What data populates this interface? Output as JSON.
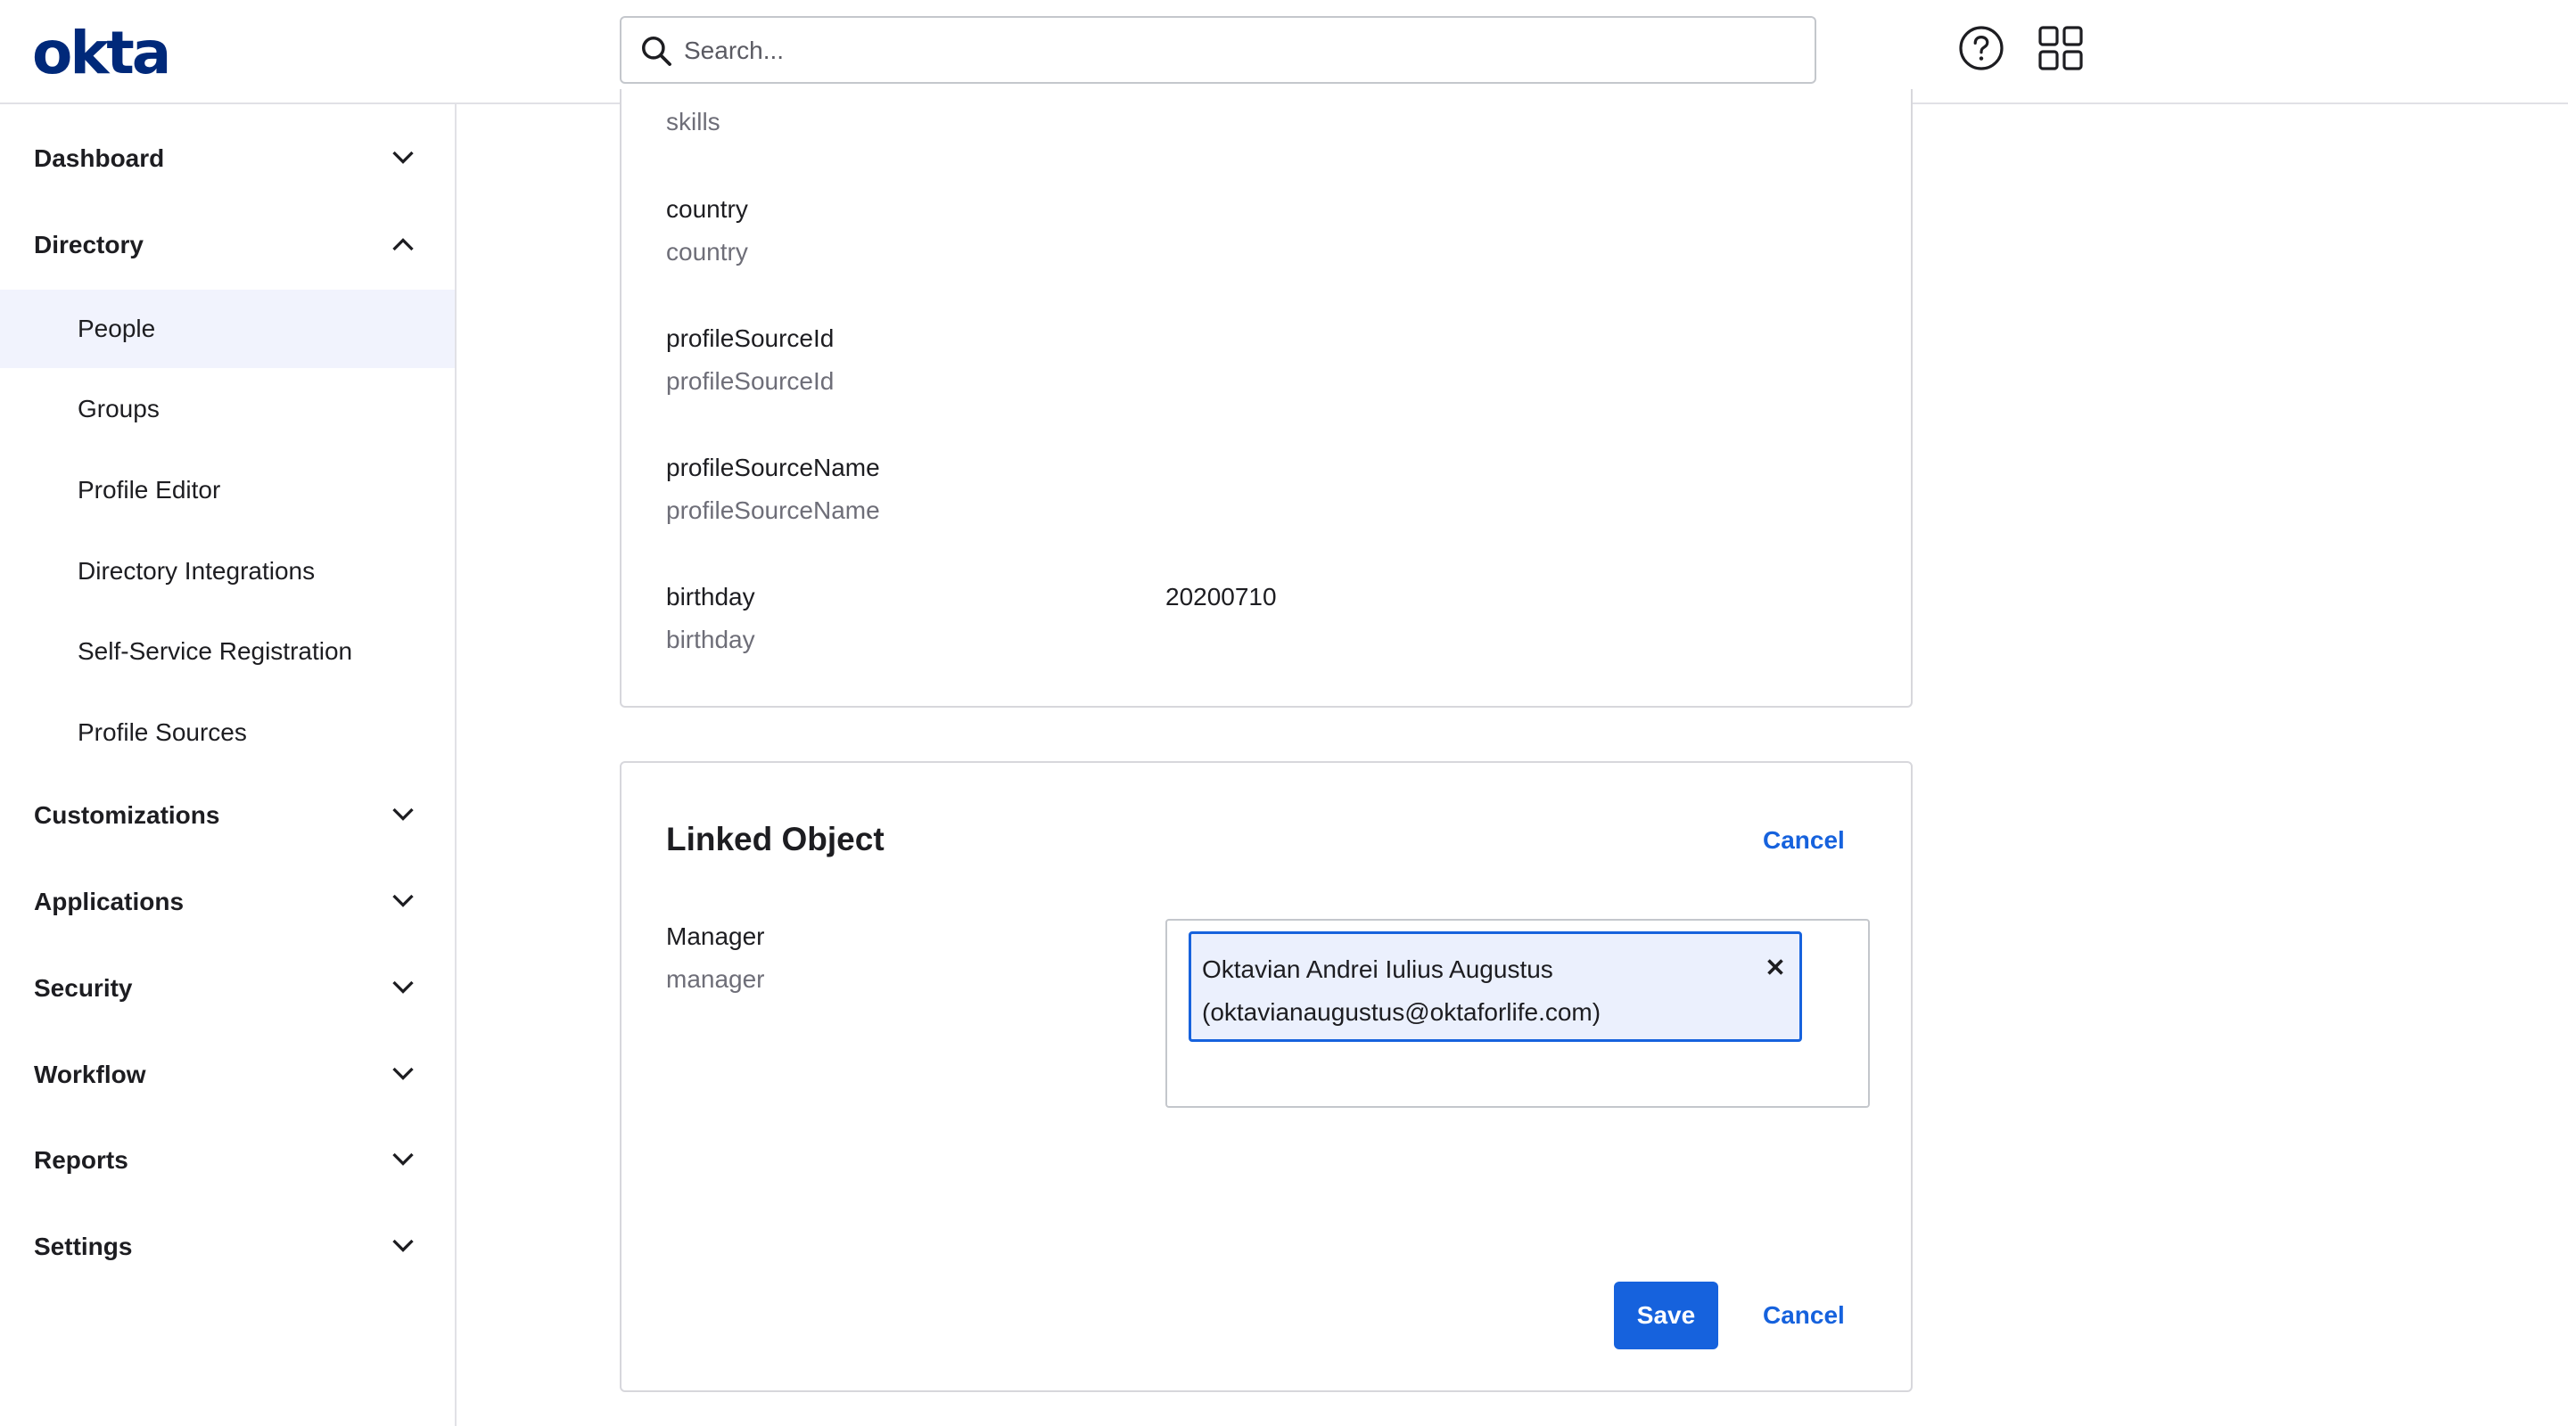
{
  "brand": {
    "logo_text": "okta",
    "logo_color": "#00297a",
    "accent_color": "#1662dd"
  },
  "header": {
    "search_placeholder": "Search...",
    "icons": [
      "search-icon",
      "help-icon",
      "apps-grid-icon"
    ]
  },
  "sidebar": {
    "sections": [
      {
        "label": "Dashboard",
        "expanded": false
      },
      {
        "label": "Directory",
        "expanded": true
      },
      {
        "label": "Customizations",
        "expanded": false
      },
      {
        "label": "Applications",
        "expanded": false
      },
      {
        "label": "Security",
        "expanded": false
      },
      {
        "label": "Workflow",
        "expanded": false
      },
      {
        "label": "Reports",
        "expanded": false
      },
      {
        "label": "Settings",
        "expanded": false
      }
    ],
    "directory_items": [
      {
        "label": "People",
        "active": true
      },
      {
        "label": "Groups",
        "active": false
      },
      {
        "label": "Profile Editor",
        "active": false
      },
      {
        "label": "Directory Integrations",
        "active": false
      },
      {
        "label": "Self-Service Registration",
        "active": false
      },
      {
        "label": "Profile Sources",
        "active": false
      }
    ]
  },
  "attributes": [
    {
      "name": "",
      "variable": "skills",
      "value": ""
    },
    {
      "name": "country",
      "variable": "country",
      "value": ""
    },
    {
      "name": "profileSourceId",
      "variable": "profileSourceId",
      "value": ""
    },
    {
      "name": "profileSourceName",
      "variable": "profileSourceName",
      "value": ""
    },
    {
      "name": "birthday",
      "variable": "birthday",
      "value": "20200710"
    }
  ],
  "linked_object": {
    "title": "Linked Object",
    "cancel_top_label": "Cancel",
    "manager": {
      "name": "Manager",
      "variable": "manager",
      "selected_line1": "Oktavian Andrei Iulius Augustus",
      "selected_line2": "(oktavianaugustus@oktaforlife.com)"
    },
    "save_label": "Save",
    "cancel_bottom_label": "Cancel"
  }
}
